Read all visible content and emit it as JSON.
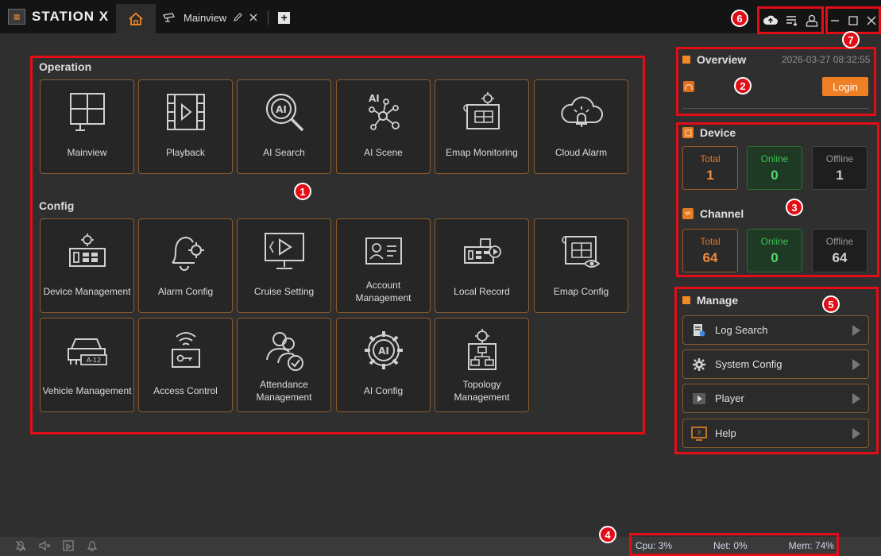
{
  "app": {
    "name": "STATION X"
  },
  "tabs": {
    "main_label": "Mainview"
  },
  "sections": {
    "operation": "Operation",
    "config": "Config"
  },
  "operation_tiles": [
    {
      "label": "Mainview",
      "icon": "mainview-icon"
    },
    {
      "label": "Playback",
      "icon": "playback-icon"
    },
    {
      "label": "AI Search",
      "icon": "ai-search-icon"
    },
    {
      "label": "AI Scene",
      "icon": "ai-scene-icon"
    },
    {
      "label": "Emap Monitoring",
      "icon": "emap-monitoring-icon"
    },
    {
      "label": "Cloud Alarm",
      "icon": "cloud-alarm-icon"
    }
  ],
  "config_tiles": [
    {
      "label": "Device Management",
      "icon": "device-management-icon"
    },
    {
      "label": "Alarm Config",
      "icon": "alarm-config-icon"
    },
    {
      "label": "Cruise Setting",
      "icon": "cruise-setting-icon"
    },
    {
      "label": "Account Management",
      "icon": "account-management-icon"
    },
    {
      "label": "Local Record",
      "icon": "local-record-icon"
    },
    {
      "label": "Emap Config",
      "icon": "emap-config-icon"
    },
    {
      "label": "Vehicle Management",
      "icon": "vehicle-management-icon"
    },
    {
      "label": "Access Control",
      "icon": "access-control-icon"
    },
    {
      "label": "Attendance Management",
      "icon": "attendance-management-icon"
    },
    {
      "label": "AI Config",
      "icon": "ai-config-icon"
    },
    {
      "label": "Topology Management",
      "icon": "topology-management-icon"
    }
  ],
  "overview": {
    "title": "Overview",
    "datetime": "2026-03-27 08:32:55",
    "login_label": "Login"
  },
  "device": {
    "title": "Device",
    "total_label": "Total",
    "total": "1",
    "online_label": "Online",
    "online": "0",
    "offline_label": "Offline",
    "offline": "1"
  },
  "channel": {
    "title": "Channel",
    "total_label": "Total",
    "total": "64",
    "online_label": "Online",
    "online": "0",
    "offline_label": "Offline",
    "offline": "64"
  },
  "manage": {
    "title": "Manage",
    "items": [
      {
        "label": "Log Search",
        "icon": "log-search-icon"
      },
      {
        "label": "System Config",
        "icon": "gear-icon"
      },
      {
        "label": "Player",
        "icon": "player-icon"
      },
      {
        "label": "Help",
        "icon": "help-icon"
      }
    ]
  },
  "status": {
    "cpu": "Cpu: 3%",
    "net": "Net: 0%",
    "mem": "Mem: 74%"
  },
  "annotations": [
    "1",
    "2",
    "3",
    "4",
    "5",
    "6",
    "7"
  ],
  "colors": {
    "accent": "#ef7f25",
    "annotation": "#e30d17",
    "online": "#56d36b"
  }
}
